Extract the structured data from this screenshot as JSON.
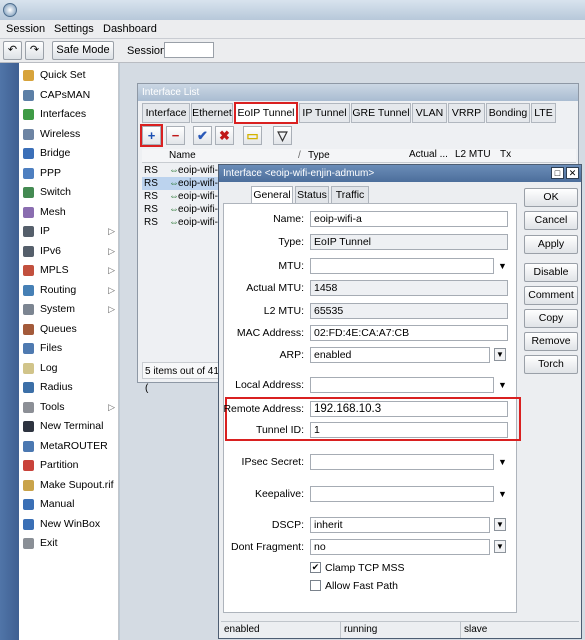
{
  "menu": [
    "Session",
    "Settings",
    "Dashboard"
  ],
  "toolbar": {
    "undo_icon": "undo-icon",
    "redo_icon": "redo-icon",
    "safe_mode": "Safe Mode",
    "session_label": "Session:",
    "session_value": ""
  },
  "sidebar": {
    "items": [
      {
        "label": "Quick Set",
        "color": "#d7a33b",
        "arrow": ""
      },
      {
        "label": "CAPsMAN",
        "color": "#5c7fa6",
        "arrow": ""
      },
      {
        "label": "Interfaces",
        "color": "#3e9b45",
        "arrow": ""
      },
      {
        "label": "Wireless",
        "color": "#6d84a3",
        "arrow": ""
      },
      {
        "label": "Bridge",
        "color": "#3b6fb8",
        "arrow": ""
      },
      {
        "label": "PPP",
        "color": "#4e7fc0",
        "arrow": ""
      },
      {
        "label": "Switch",
        "color": "#448a52",
        "arrow": ""
      },
      {
        "label": "Mesh",
        "color": "#8a6db0",
        "arrow": ""
      },
      {
        "label": "IP",
        "color": "#555f6b",
        "arrow": "▷"
      },
      {
        "label": "IPv6",
        "color": "#555f6b",
        "arrow": "▷"
      },
      {
        "label": "MPLS",
        "color": "#c2503e",
        "arrow": "▷"
      },
      {
        "label": "Routing",
        "color": "#4680b5",
        "arrow": "▷"
      },
      {
        "label": "System",
        "color": "#7c8591",
        "arrow": "▷"
      },
      {
        "label": "Queues",
        "color": "#a35a3a",
        "arrow": ""
      },
      {
        "label": "Files",
        "color": "#4f7ab0",
        "arrow": ""
      },
      {
        "label": "Log",
        "color": "#d1c48a",
        "arrow": ""
      },
      {
        "label": "Radius",
        "color": "#3c6fa7",
        "arrow": ""
      },
      {
        "label": "Tools",
        "color": "#8c8f96",
        "arrow": "▷"
      },
      {
        "label": "New Terminal",
        "color": "#2e3440",
        "arrow": ""
      },
      {
        "label": "MetaROUTER",
        "color": "#4b78b1",
        "arrow": ""
      },
      {
        "label": "Partition",
        "color": "#c9423a",
        "arrow": ""
      },
      {
        "label": "Make Supout.rif",
        "color": "#c9a34a",
        "arrow": ""
      },
      {
        "label": "Manual",
        "color": "#3a6fb5",
        "arrow": ""
      },
      {
        "label": "New WinBox",
        "color": "#3a6fb5",
        "arrow": ""
      },
      {
        "label": "Exit",
        "color": "#8a8f96",
        "arrow": ""
      }
    ]
  },
  "list": {
    "title": "Interface List",
    "tabs": [
      "Interface",
      "Ethernet",
      "EoIP Tunnel",
      "IP Tunnel",
      "GRE Tunnel",
      "VLAN",
      "VRRP",
      "Bonding",
      "LTE"
    ],
    "cols": [
      "Name",
      "Type",
      "Actual ...",
      "L2 MTU",
      "Tx"
    ],
    "rows": [
      {
        "flag": "RS",
        "name": "eoip-wifi-"
      },
      {
        "flag": "RS",
        "name": "eoip-wifi-"
      },
      {
        "flag": "RS",
        "name": "eoip-wifi-"
      },
      {
        "flag": "RS",
        "name": "eoip-wifi-"
      },
      {
        "flag": "RS",
        "name": "eoip-wifi-"
      }
    ],
    "status": "5 items out of 41 ("
  },
  "dialog": {
    "title": "Interface <eoip-wifi-enjin-admum>",
    "tabs": [
      "General",
      "Status",
      "Traffic"
    ],
    "fields": {
      "name_label": "Name:",
      "name": "eoip-wifi-a",
      "type_label": "Type:",
      "type": "EoIP Tunnel",
      "mtu_label": "MTU:",
      "mtu": "",
      "actual_mtu_label": "Actual MTU:",
      "actual_mtu": "1458",
      "l2mtu_label": "L2 MTU:",
      "l2mtu": "65535",
      "mac_label": "MAC Address:",
      "mac": "02:FD:4E:CA:A7:CB",
      "arp_label": "ARP:",
      "arp": "enabled",
      "local_label": "Local Address:",
      "local": "",
      "remote_label": "Remote Address:",
      "remote": "192.168.10.3",
      "tunnel_label": "Tunnel ID:",
      "tunnel": "1",
      "ipsec_label": "IPsec Secret:",
      "ipsec": "",
      "keepalive_label": "Keepalive:",
      "keepalive": "",
      "dscp_label": "DSCP:",
      "dscp": "inherit",
      "dontfrag_label": "Dont Fragment:",
      "dontfrag": "no",
      "clamp_label": "Clamp TCP MSS",
      "allow_label": "Allow Fast Path"
    },
    "buttons": [
      "OK",
      "Cancel",
      "Apply",
      "Disable",
      "Comment",
      "Copy",
      "Remove",
      "Torch"
    ],
    "status": [
      "enabled",
      "running",
      "slave"
    ]
  }
}
